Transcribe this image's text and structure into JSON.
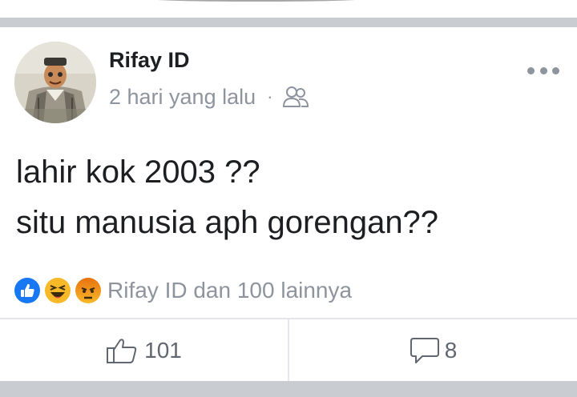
{
  "post": {
    "author": "Rifay ID",
    "time": "2 hari yang lalu",
    "separator": "·",
    "audience_icon": "friends-icon",
    "lines": [
      "lahir kok 2003 ??",
      "situ manusia aph gorengan??"
    ]
  },
  "reactions": {
    "icons": [
      "like-icon",
      "haha-icon",
      "angry-icon"
    ],
    "summary": "Rifay ID dan 100 lainnya"
  },
  "actions": {
    "like_count": "101",
    "comment_count": "8"
  },
  "colors": {
    "like_blue": "#1877f2",
    "haha_yellow": "#f7b928",
    "angry_orange": "#e9710f",
    "meta_gray": "#8d949e",
    "separator_gray": "#c9ccd1"
  }
}
